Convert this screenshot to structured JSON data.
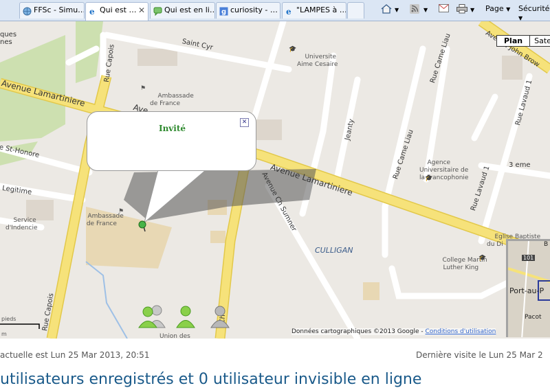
{
  "tabs": [
    {
      "label": "FFSc - Simu…",
      "icon": "globe-icon"
    },
    {
      "label": "Qui est …",
      "icon": "ie-icon",
      "active": true
    },
    {
      "label": "Qui est en li…",
      "icon": "chat-icon"
    },
    {
      "label": "curiosity - …",
      "icon": "google-icon"
    },
    {
      "label": "\"LAMPES à …",
      "icon": "ie-icon"
    }
  ],
  "commands": {
    "page": "Page",
    "security": "Sécurité"
  },
  "map": {
    "type_buttons": {
      "plan": "Plan",
      "satellite": "Sate"
    },
    "streets": {
      "saint_cyr": "Saint Cyr",
      "lamartiniere_left": "Avenue Lamartiniere",
      "lamartiniere_right": "Avenue Lamartiniere",
      "ave_top": "Ave",
      "rue_capois_top": "Rue Capois",
      "rue_capois_bottom": "Rue Capois",
      "st_honore": "e St-Honore",
      "legitime": "Legitime",
      "ch_sumner": "Avenue Ch Sumner",
      "jeanty": "Jeanty",
      "came_liau_top": "Rue Came Liau",
      "came_liau_mid": "Rue Came Liau",
      "lavaud_top": "Rue Lavaud 1",
      "lavaud_bottom": "Rue Lavaud 1",
      "troisieme": "3 eme",
      "john_brown": "Avenue John Brow",
      "ch_bottom": "Ch",
      "culligan": "CULLIGAN",
      "ques_nes": "ques\nnes"
    },
    "pois": {
      "universite": "Universite\nAime Cesaire",
      "ambassade1": "Ambassade\nde France",
      "ambassade2": "Ambassade\nde France",
      "agence": "Agence\nUniversitaire de\nla Francophonie",
      "eglise": "Eglise Baptiste\ndu Di",
      "college": "College Martin\nLuther King",
      "service": "Service\nd'Indencie",
      "union": "Union des"
    },
    "bubble_title": "Invité",
    "minimap": {
      "label": "Port-au-P",
      "badge": "101",
      "pacot": "Pacot",
      "b": "B"
    },
    "scale": {
      "top": "pieds",
      "bottom": "m"
    },
    "copyright": "Données cartographiques ©2013 Google - ",
    "terms_link": "Conditions d'utilisation"
  },
  "footer": {
    "current_time": "actuelle est Lun 25 Mar 2013, 20:51",
    "last_visit": "Dernière visite le Lun 25 Mar 2",
    "users_line": "utilisateurs enregistrés et 0 utilisateur invisible en ligne"
  },
  "colors": {
    "road_major": "#f6e27a",
    "road_major_edge": "#e2c84a",
    "road_minor": "#ffffff",
    "park": "#cde0b0",
    "bubble_title": "#2f8a2f",
    "heading_blue": "#1a5a8a"
  }
}
